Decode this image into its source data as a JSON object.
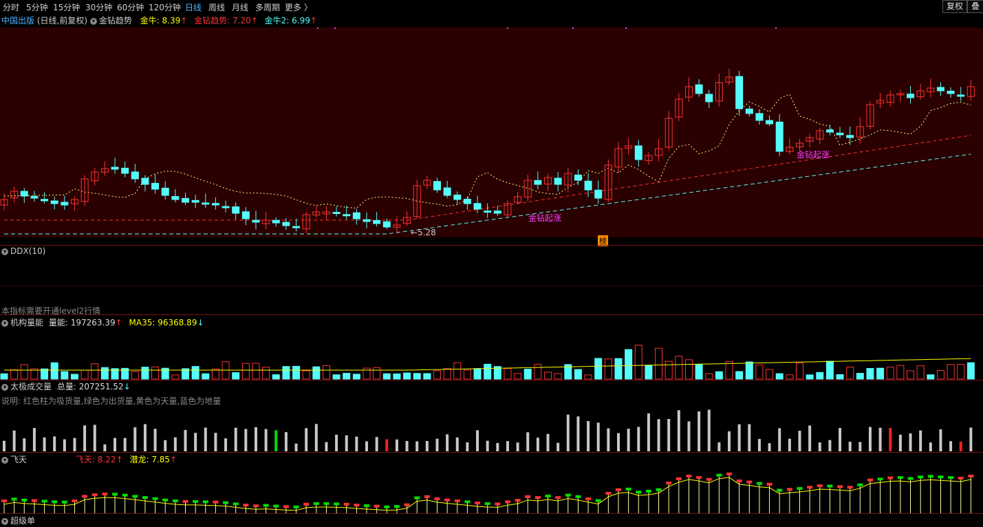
{
  "toolbar": {
    "periods": [
      "分时",
      "5分钟",
      "15分钟",
      "30分钟",
      "60分钟",
      "120分钟",
      "日线",
      "周线",
      "月线",
      "多周期",
      "更多 〉"
    ],
    "active": "日线",
    "fuquan": "复权",
    "diejia": "叠加"
  },
  "main": {
    "stock": "中国出版",
    "mode": "(日线,前复权)",
    "indicator": "金钻趋势",
    "l1": "金牛: 8.39",
    "l2": "金钻趋势: 7.20",
    "l3": "金牛2: 6.99",
    "up": "↑",
    "low_price": "←5.28",
    "signal": "金钻起涨",
    "bang": "榜"
  },
  "ddx": {
    "title": "DDX(10)",
    "note": "本指标需要开通level2行情"
  },
  "jgln": {
    "title": "机构量能",
    "v1": "量能: 197263.39",
    "v2": "MA35: 96368.89",
    "arrow_up": "↑",
    "arrow_down": "↓"
  },
  "tj": {
    "title": "太极成交量",
    "v1": "总量: 207251.52",
    "arrow": "↓",
    "desc": "说明: 红色柱为吸货量,绿色为出货量,黄色为天量,蓝色为地量"
  },
  "ft": {
    "title": "飞天",
    "v1": "飞天: 8.22",
    "v2": "潜龙: 7.85",
    "arrow": "↑"
  },
  "cjd": {
    "title": "超级单"
  },
  "colors": {
    "up": "#ff3232",
    "down": "#54fcfc",
    "yellow": "#ffff00",
    "bg_main": "#2a0000",
    "grid": "#7a1010",
    "magenta": "#ff40ff"
  }
}
